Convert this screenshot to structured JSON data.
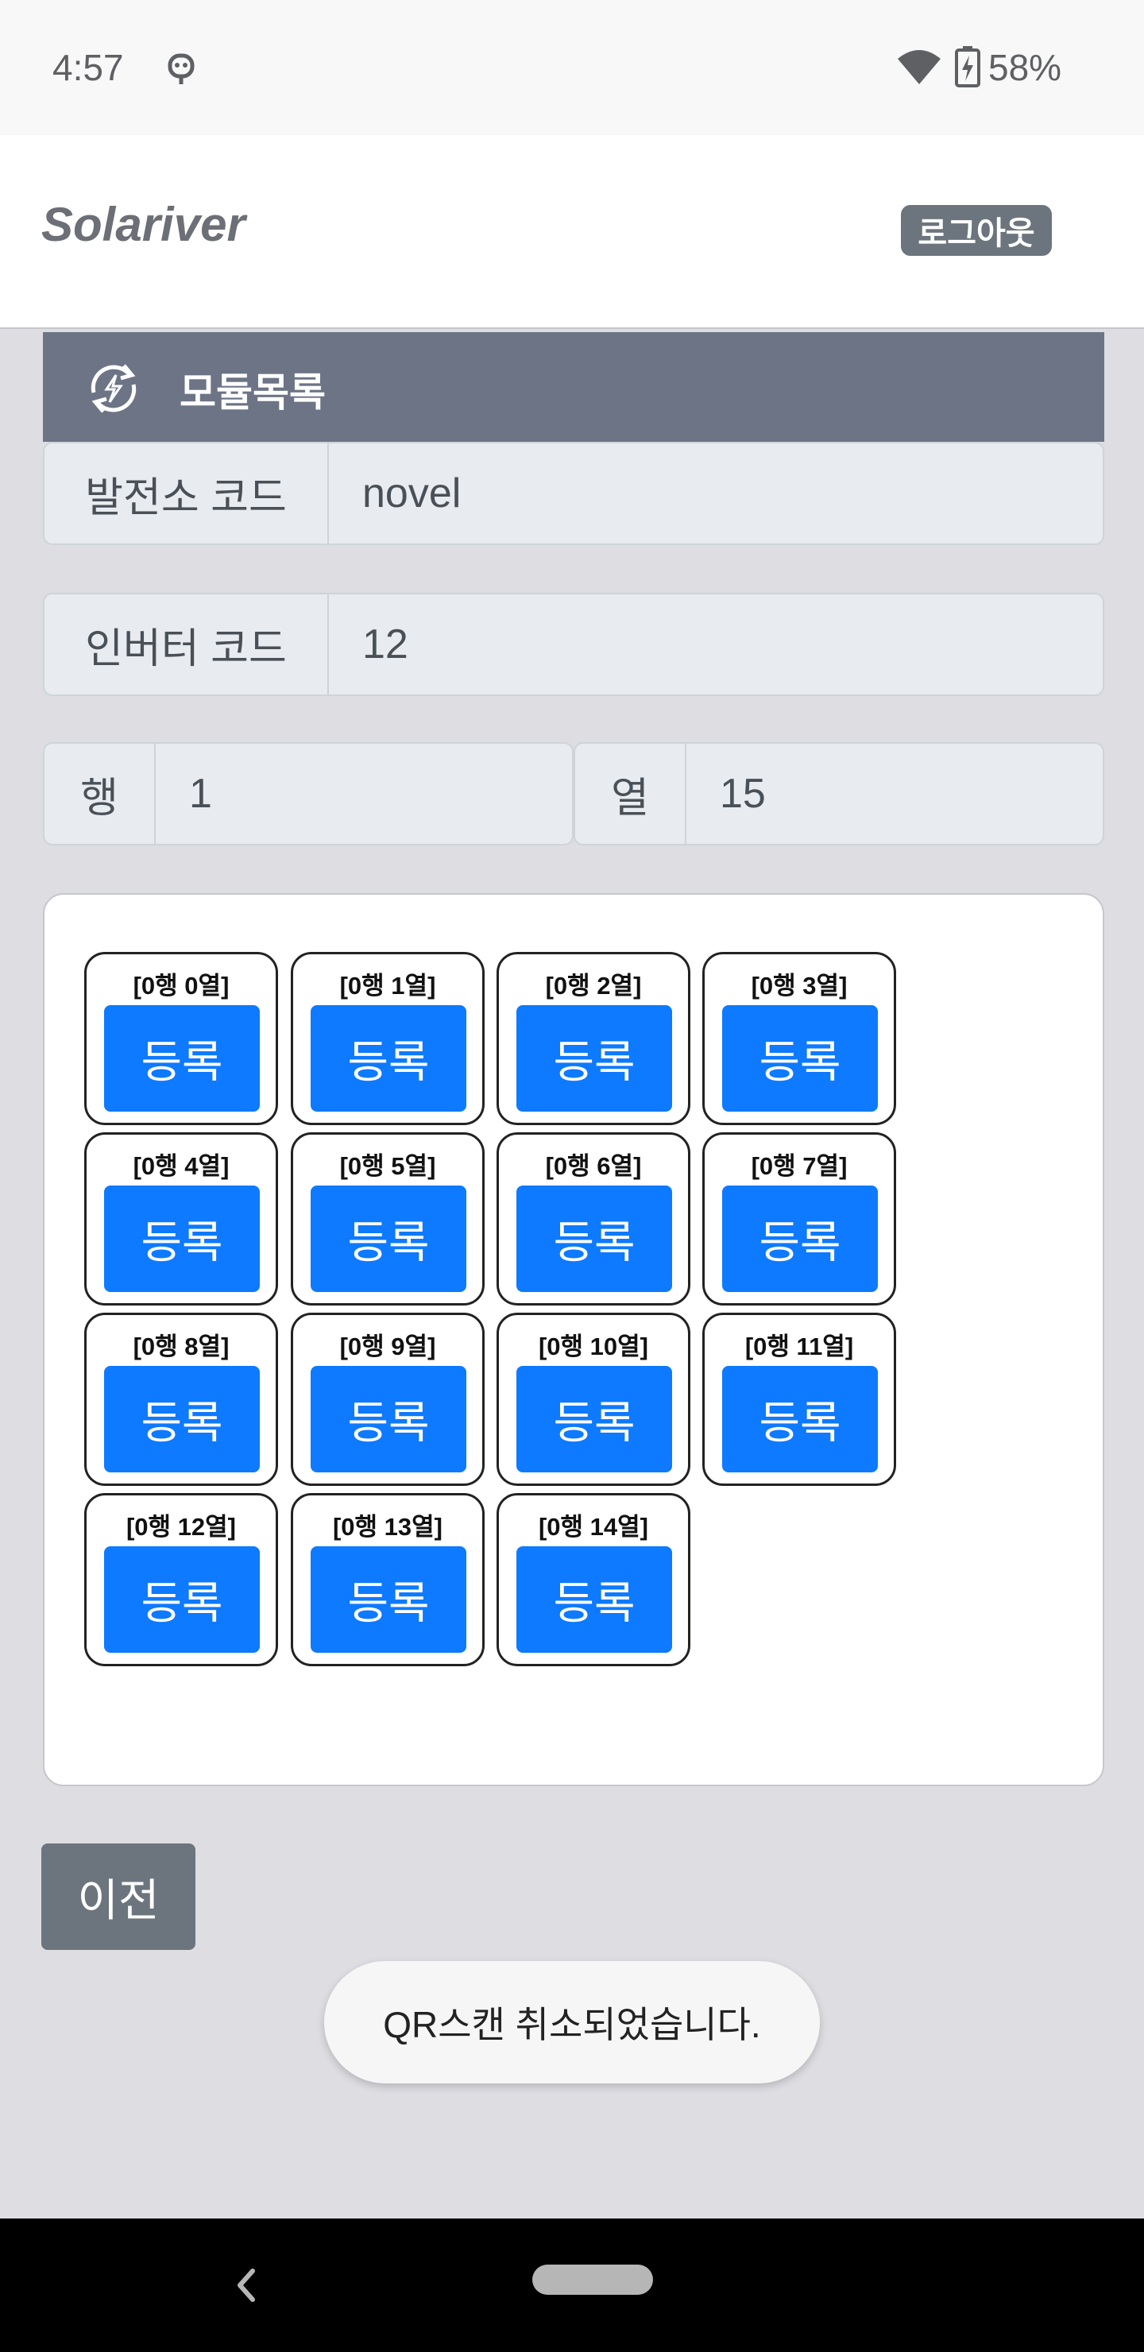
{
  "status_bar": {
    "time": "4:57",
    "battery": "58%",
    "icons": [
      "robot-icon",
      "wifi-icon",
      "battery-charging-icon"
    ]
  },
  "header": {
    "brand": "Solariver",
    "logout_label": "로그아웃"
  },
  "card": {
    "title": "모듈목록",
    "icon": "sync-icon"
  },
  "fields": {
    "plant_code": {
      "label": "발전소 코드",
      "value": "novel"
    },
    "inverter_code": {
      "label": "인버터 코드",
      "value": "12"
    },
    "row": {
      "label": "행",
      "value": "1"
    },
    "col": {
      "label": "열",
      "value": "15"
    }
  },
  "modules": [
    {
      "label": "[0행 0열]",
      "button": "등록"
    },
    {
      "label": "[0행 1열]",
      "button": "등록"
    },
    {
      "label": "[0행 2열]",
      "button": "등록"
    },
    {
      "label": "[0행 3열]",
      "button": "등록"
    },
    {
      "label": "[0행 4열]",
      "button": "등록"
    },
    {
      "label": "[0행 5열]",
      "button": "등록"
    },
    {
      "label": "[0행 6열]",
      "button": "등록"
    },
    {
      "label": "[0행 7열]",
      "button": "등록"
    },
    {
      "label": "[0행 8열]",
      "button": "등록"
    },
    {
      "label": "[0행 9열]",
      "button": "등록"
    },
    {
      "label": "[0행 10열]",
      "button": "등록"
    },
    {
      "label": "[0행 11열]",
      "button": "등록"
    },
    {
      "label": "[0행 12열]",
      "button": "등록"
    },
    {
      "label": "[0행 13열]",
      "button": "등록"
    },
    {
      "label": "[0행 14열]",
      "button": "등록"
    }
  ],
  "prev_label": "이전",
  "toast": "QR스캔 취소되었습니다.",
  "colors": {
    "primary": "#0d7aff",
    "secondary": "#6c757d",
    "card_header": "#6c7485",
    "background": "#dddde2"
  }
}
